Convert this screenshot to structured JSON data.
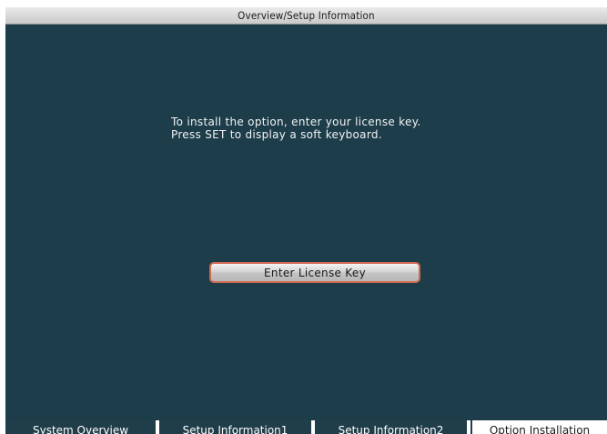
{
  "window": {
    "title": "Overview/Setup Information"
  },
  "main": {
    "instruction_line1": "To install the option, enter your license key.",
    "instruction_line2": "Press SET to display a soft keyboard.",
    "enter_license_key_label": "Enter License Key"
  },
  "tabs": [
    {
      "label": "System Overview",
      "active": false
    },
    {
      "label": "Setup Information1",
      "active": false
    },
    {
      "label": "Setup Information2",
      "active": false
    },
    {
      "label": "Option Installation",
      "active": true
    }
  ],
  "colors": {
    "screen_background": "#1e3d4a",
    "button_border": "#d06a50",
    "text": "#f1f3f4"
  }
}
